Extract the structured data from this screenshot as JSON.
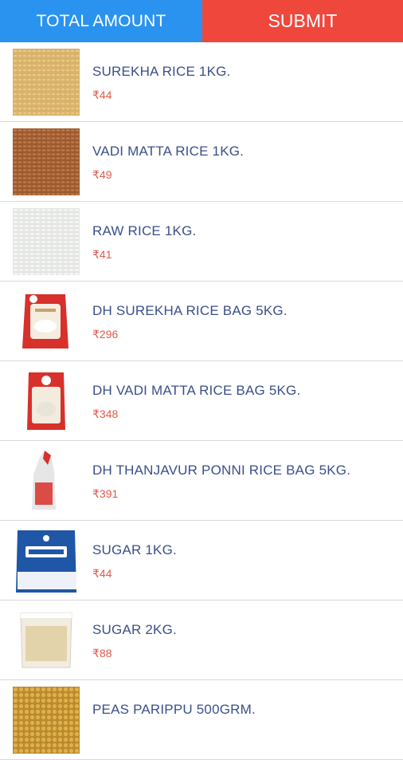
{
  "header": {
    "total_label": "TOTAL AMOUNT",
    "submit_label": "SUBMIT"
  },
  "colors": {
    "total_bg": "#2a93ef",
    "submit_bg": "#f0473c",
    "name_text": "#3b4f8a",
    "price_text": "#e05a4a"
  },
  "products": [
    {
      "name": "SUREKHA RICE 1KG.",
      "price": "₹44",
      "icon": "rice-grains-icon"
    },
    {
      "name": "VADI MATTA RICE 1KG.",
      "price": "₹49",
      "icon": "matta-rice-grains-icon"
    },
    {
      "name": "RAW RICE 1KG.",
      "price": "₹41",
      "icon": "raw-rice-icon"
    },
    {
      "name": "DH SUREKHA RICE BAG 5KG.",
      "price": "₹296",
      "icon": "rice-bag-icon"
    },
    {
      "name": "DH VADI MATTA RICE BAG 5KG.",
      "price": "₹348",
      "icon": "rice-bag-icon"
    },
    {
      "name": "DH THANJAVUR PONNI RICE BAG 5KG.",
      "price": "₹391",
      "icon": "rice-sack-icon"
    },
    {
      "name": "SUGAR 1KG.",
      "price": "₹44",
      "icon": "sugar-pack-icon"
    },
    {
      "name": "SUGAR 2KG.",
      "price": "₹88",
      "icon": "sugar-bag-icon"
    },
    {
      "name": "PEAS PARIPPU 500GRM.",
      "price": "",
      "icon": "peas-grains-icon"
    }
  ]
}
